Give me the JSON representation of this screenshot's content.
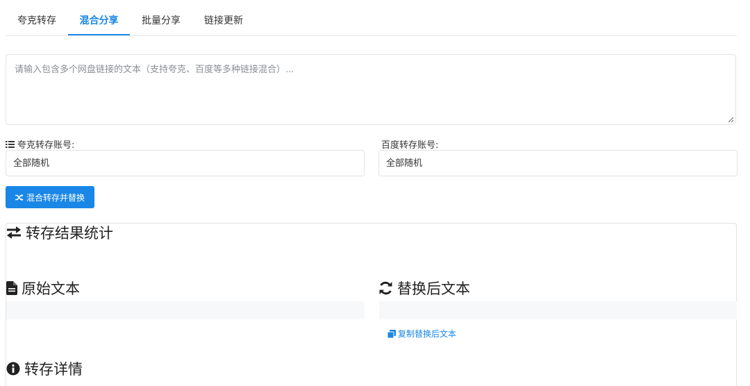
{
  "tabs": [
    {
      "label": "夸克转存",
      "active": false
    },
    {
      "label": "混合分享",
      "active": true
    },
    {
      "label": "批量分享",
      "active": false
    },
    {
      "label": "链接更新",
      "active": false
    }
  ],
  "input": {
    "placeholder": "请输入包含多个网盘链接的文本（支持夸克、百度等多种链接混合）...",
    "value": ""
  },
  "quark_account": {
    "label": "夸克转存账号:",
    "selected": "全部随机",
    "icon": "list-icon"
  },
  "baidu_account": {
    "label": "百度转存账号:",
    "selected": "全部随机"
  },
  "mix_button": {
    "label": "混合转存并替换",
    "icon": "shuffle-icon"
  },
  "results": {
    "stats_title": "转存结果统计",
    "original_title": "原始文本",
    "replaced_title": "替换后文本",
    "copy_label": "复制替换后文本",
    "details_title": "转存详情"
  },
  "colors": {
    "accent": "#1a87e6",
    "border": "#dfe3e8",
    "placeholder_bg": "#f7f8fa"
  }
}
